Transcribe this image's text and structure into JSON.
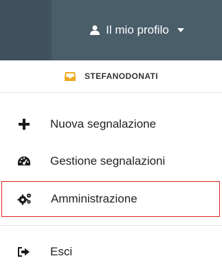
{
  "header": {
    "profile_label": "Il mio profilo"
  },
  "user": {
    "username": "STEFANODONATI"
  },
  "menu": {
    "items": [
      {
        "label": "Nuova segnalazione",
        "icon": "plus-icon"
      },
      {
        "label": "Gestione segnalazioni",
        "icon": "tachometer-icon"
      },
      {
        "label": "Amministrazione",
        "icon": "cogs-icon",
        "highlighted": true
      },
      {
        "label": "Esci",
        "icon": "sign-out-icon"
      }
    ]
  },
  "colors": {
    "topbar": "#4a5e6a",
    "topbar_left": "#3f525d",
    "inbox_icon": "#f0a81c",
    "highlight_border": "#e02020"
  }
}
